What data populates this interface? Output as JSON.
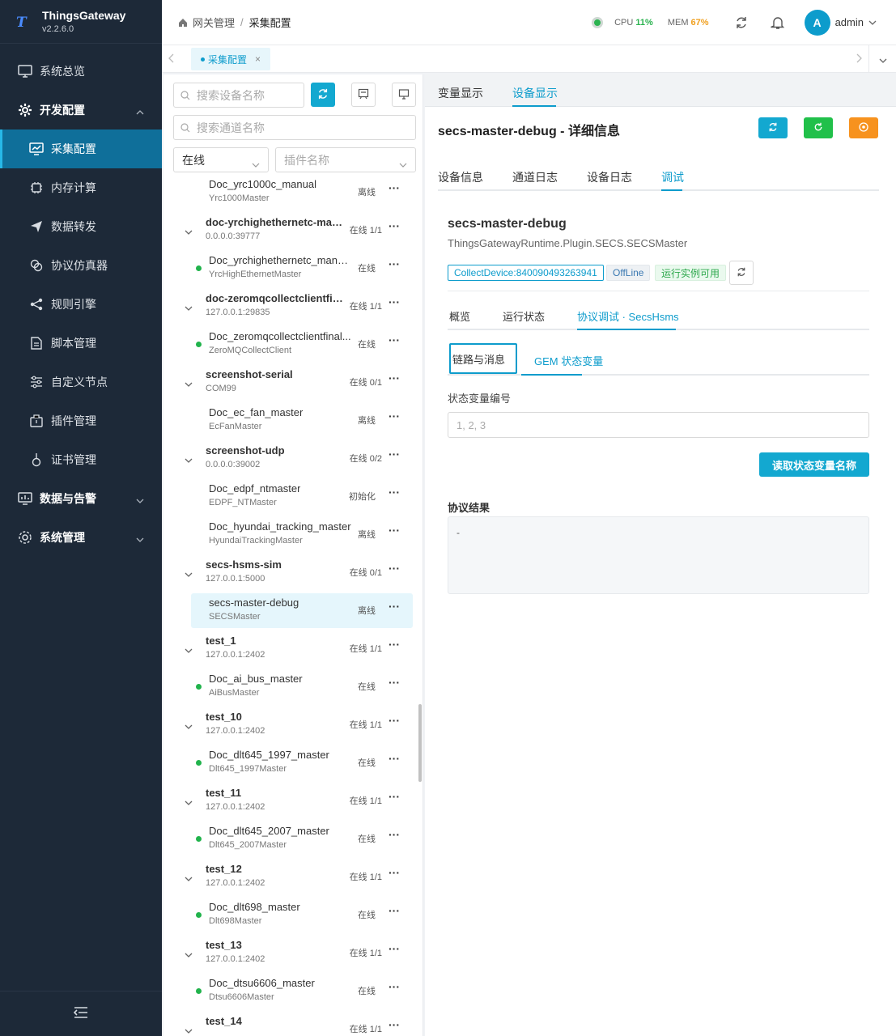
{
  "app": {
    "name": "ThingsGateway",
    "version": "v2.2.6.0"
  },
  "sidebar": {
    "items": [
      {
        "label": "系统总览"
      },
      {
        "label": "开发配置"
      },
      {
        "label": "采集配置"
      },
      {
        "label": "内存计算"
      },
      {
        "label": "数据转发"
      },
      {
        "label": "协议仿真器"
      },
      {
        "label": "规则引擎"
      },
      {
        "label": "脚本管理"
      },
      {
        "label": "自定义节点"
      },
      {
        "label": "插件管理"
      },
      {
        "label": "证书管理"
      },
      {
        "label": "数据与告警"
      },
      {
        "label": "系统管理"
      }
    ]
  },
  "header": {
    "breadcrumb": [
      "网关管理",
      "/",
      "采集配置"
    ],
    "cpu_label": "CPU",
    "cpu_value": "11%",
    "mem_label": "MEM",
    "mem_value": "67%",
    "avatar_letter": "A",
    "username": "admin",
    "colors": {
      "cpu": "#2bb350",
      "mem": "#f0a020"
    }
  },
  "page_tabs": [
    {
      "label": "采集配置",
      "close": "×"
    }
  ],
  "left": {
    "search_device_placeholder": "搜索设备名称",
    "search_channel_placeholder": "搜索通道名称",
    "status_select": "在线",
    "plugin_select_placeholder": "插件名称"
  },
  "tree": [
    {
      "kind": "device",
      "name": "Doc_yrc1000c_manual",
      "sub": "Yrc1000Master",
      "status": "离线",
      "online": false
    },
    {
      "kind": "channel",
      "name": "doc-yrchighethernetc-man...",
      "sub": "0.0.0.0:39777",
      "status": "在线 1/1"
    },
    {
      "kind": "device",
      "name": "Doc_yrchighethernetc_manual",
      "sub": "YrcHighEthernetMaster",
      "status": "在线",
      "online": true
    },
    {
      "kind": "channel",
      "name": "doc-zeromqcollectclientfin...",
      "sub": "127.0.0.1:29835",
      "status": "在线 1/1"
    },
    {
      "kind": "device",
      "name": "Doc_zeromqcollectclientfinal...",
      "sub": "ZeroMQCollectClient",
      "status": "在线",
      "online": true
    },
    {
      "kind": "channel",
      "name": "screenshot-serial",
      "sub": "COM99",
      "status": "在线 0/1"
    },
    {
      "kind": "device",
      "name": "Doc_ec_fan_master",
      "sub": "EcFanMaster",
      "status": "离线",
      "online": false
    },
    {
      "kind": "channel",
      "name": "screenshot-udp",
      "sub": "0.0.0.0:39002",
      "status": "在线 0/2"
    },
    {
      "kind": "device",
      "name": "Doc_edpf_ntmaster",
      "sub": "EDPF_NTMaster",
      "status": "初始化",
      "online": false
    },
    {
      "kind": "device",
      "name": "Doc_hyundai_tracking_master",
      "sub": "HyundaiTrackingMaster",
      "status": "离线",
      "online": false
    },
    {
      "kind": "channel",
      "name": "secs-hsms-sim",
      "sub": "127.0.0.1:5000",
      "status": "在线 0/1"
    },
    {
      "kind": "device",
      "name": "secs-master-debug",
      "sub": "SECSMaster",
      "status": "离线",
      "online": false,
      "selected": true
    },
    {
      "kind": "channel",
      "name": "test_1",
      "sub": "127.0.0.1:2402",
      "status": "在线 1/1"
    },
    {
      "kind": "device",
      "name": "Doc_ai_bus_master",
      "sub": "AiBusMaster",
      "status": "在线",
      "online": true
    },
    {
      "kind": "channel",
      "name": "test_10",
      "sub": "127.0.0.1:2402",
      "status": "在线 1/1"
    },
    {
      "kind": "device",
      "name": "Doc_dlt645_1997_master",
      "sub": "Dlt645_1997Master",
      "status": "在线",
      "online": true
    },
    {
      "kind": "channel",
      "name": "test_11",
      "sub": "127.0.0.1:2402",
      "status": "在线 1/1"
    },
    {
      "kind": "device",
      "name": "Doc_dlt645_2007_master",
      "sub": "Dlt645_2007Master",
      "status": "在线",
      "online": true
    },
    {
      "kind": "channel",
      "name": "test_12",
      "sub": "127.0.0.1:2402",
      "status": "在线 1/1"
    },
    {
      "kind": "device",
      "name": "Doc_dlt698_master",
      "sub": "Dlt698Master",
      "status": "在线",
      "online": true
    },
    {
      "kind": "channel",
      "name": "test_13",
      "sub": "127.0.0.1:2402",
      "status": "在线 1/1"
    },
    {
      "kind": "device",
      "name": "Doc_dtsu6606_master",
      "sub": "Dtsu6606Master",
      "status": "在线",
      "online": true
    },
    {
      "kind": "channel",
      "name": "test_14",
      "sub": "",
      "status": "在线 1/1"
    }
  ],
  "main": {
    "top_tabs": [
      "变量显示",
      "设备显示"
    ],
    "detail_title": "secs-master-debug - 详细信息",
    "sub_tabs": [
      "设备信息",
      "通道日志",
      "设备日志",
      "调试"
    ],
    "device_name": "secs-master-debug",
    "plugin": "ThingsGatewayRuntime.Plugin.SECS.SECSMaster",
    "tags": [
      "CollectDevice:840090493263941",
      "OffLine",
      "运行实例可用"
    ],
    "inner_tabs": [
      "概览",
      "运行状态",
      "协议调试 · SecsHsms"
    ],
    "proto_tabs": [
      "链路与消息",
      "GEM 状态变量"
    ],
    "field_label": "状态变量编号",
    "field_placeholder": "1, 2, 3",
    "read_button": "读取状态变量名称",
    "result_label": "协议结果",
    "result_value": "-"
  },
  "colors": {
    "accent": "#0d9ccc",
    "sidebar_bg": "#1d2938",
    "online": "#21b34c",
    "btn_green": "#21c04a",
    "btn_orange": "#f7921e"
  }
}
